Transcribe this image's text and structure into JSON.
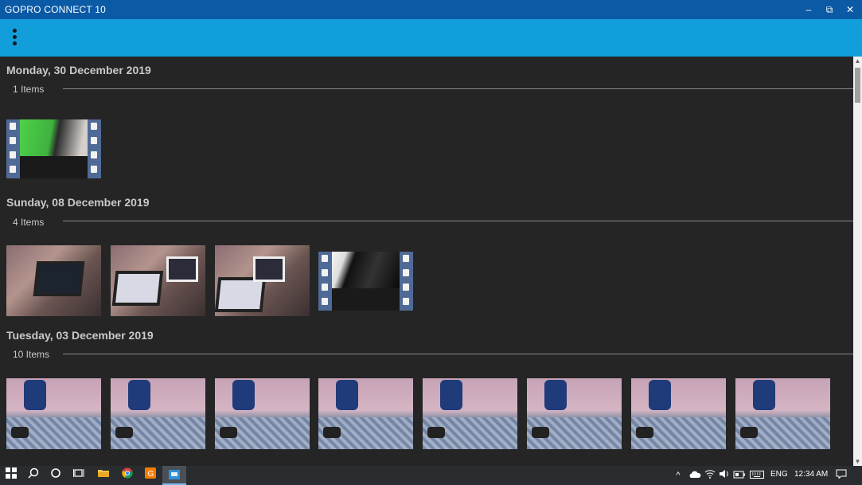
{
  "window": {
    "title": "GOPRO CONNECT 10",
    "minimize_glyph": "–",
    "restore_glyph": "⧉",
    "close_glyph": "✕"
  },
  "appbar": {
    "menu_icon": "kebab-menu-icon"
  },
  "groups": [
    {
      "date": "Monday, 30 December 2019",
      "count": "1 Items"
    },
    {
      "date": "Sunday, 08 December 2019",
      "count": "4 Items"
    },
    {
      "date": "Tuesday, 03 December 2019",
      "count": "10 Items"
    }
  ],
  "taskbar": {
    "language": "ENG",
    "time": "12:34 AM"
  }
}
